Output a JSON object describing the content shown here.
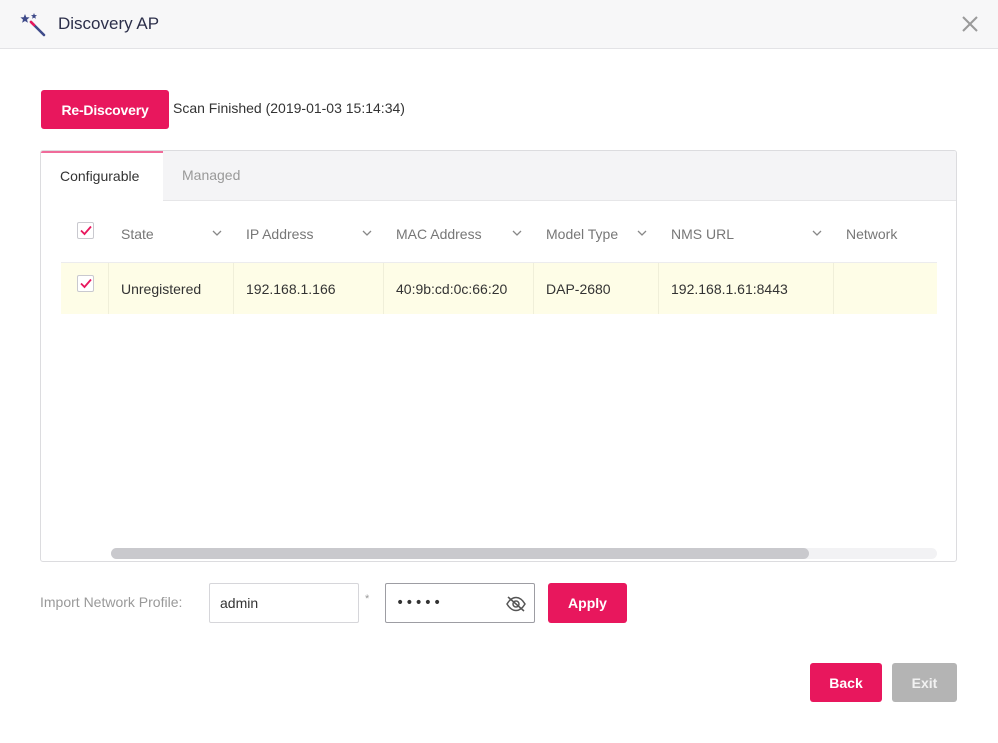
{
  "dialog": {
    "title": "Discovery AP",
    "title_icon": "magic-wand-icon",
    "close_icon": "close-icon"
  },
  "toolbar": {
    "rediscovery_label": "Re-Discovery",
    "scan_status": "Scan Finished (2019-01-03 15:14:34)"
  },
  "tabs": [
    {
      "label": "Configurable",
      "active": true
    },
    {
      "label": "Managed",
      "active": false
    }
  ],
  "table": {
    "select_all_checked": true,
    "columns": [
      {
        "label": "State",
        "sortable": true
      },
      {
        "label": "IP Address",
        "sortable": true
      },
      {
        "label": "MAC Address",
        "sortable": true
      },
      {
        "label": "Model Type",
        "sortable": true
      },
      {
        "label": "NMS URL",
        "sortable": true
      },
      {
        "label": "Network",
        "sortable": false
      }
    ],
    "rows": [
      {
        "checked": true,
        "state": "Unregistered",
        "ip_address": "192.168.1.166",
        "mac_address": "40:9b:cd:0c:66:20",
        "model_type": "DAP-2680",
        "nms_url": "192.168.1.61:8443",
        "network": ""
      }
    ]
  },
  "import": {
    "label": "Import Network Profile:",
    "username_value": "admin",
    "required_marker": "*",
    "password_value": "•••••",
    "password_icon": "eye-off-icon",
    "apply_label": "Apply"
  },
  "footer": {
    "back_label": "Back",
    "exit_label": "Exit"
  },
  "colors": {
    "accent": "#e8175d",
    "tab_active_border": "#f06b9a",
    "row_highlight": "#fefde7",
    "disabled_button": "#b4b4b4"
  }
}
